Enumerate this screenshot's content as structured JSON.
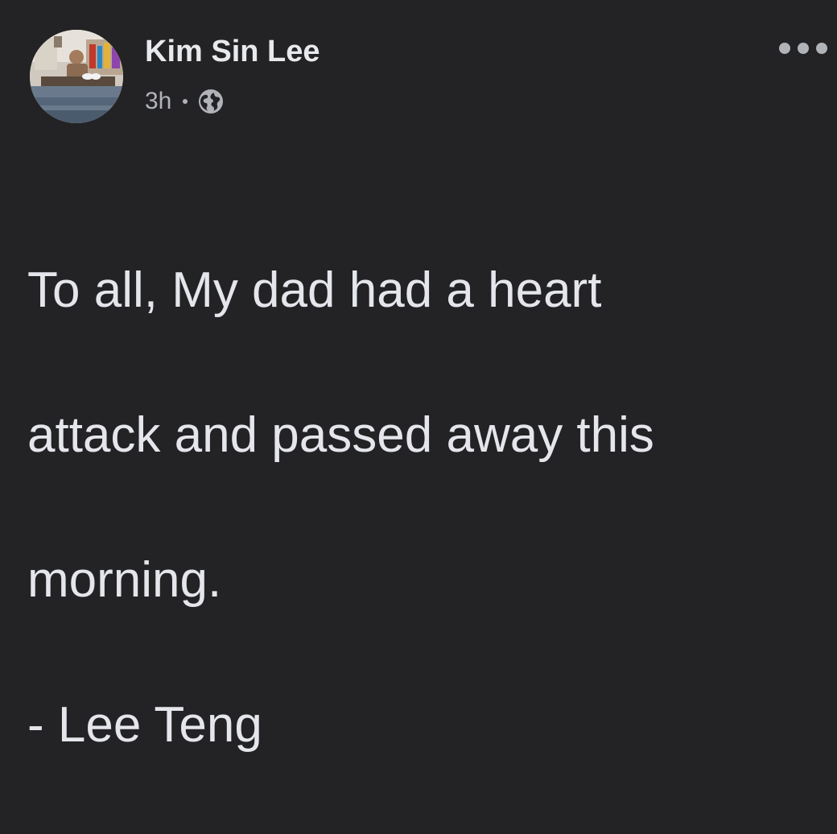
{
  "post": {
    "author_name": "Kim Sin Lee",
    "timestamp": "3h",
    "separator": "·",
    "privacy_icon": "globe-icon",
    "more_icon": "more-options-icon",
    "text_lines": [
      "To all, My dad had a heart",
      "attack and passed away this",
      "morning.",
      "- Lee Teng"
    ]
  },
  "colors": {
    "background": "#232325",
    "primary_text": "#e4e6eb",
    "secondary_text": "#b0b3b8"
  }
}
